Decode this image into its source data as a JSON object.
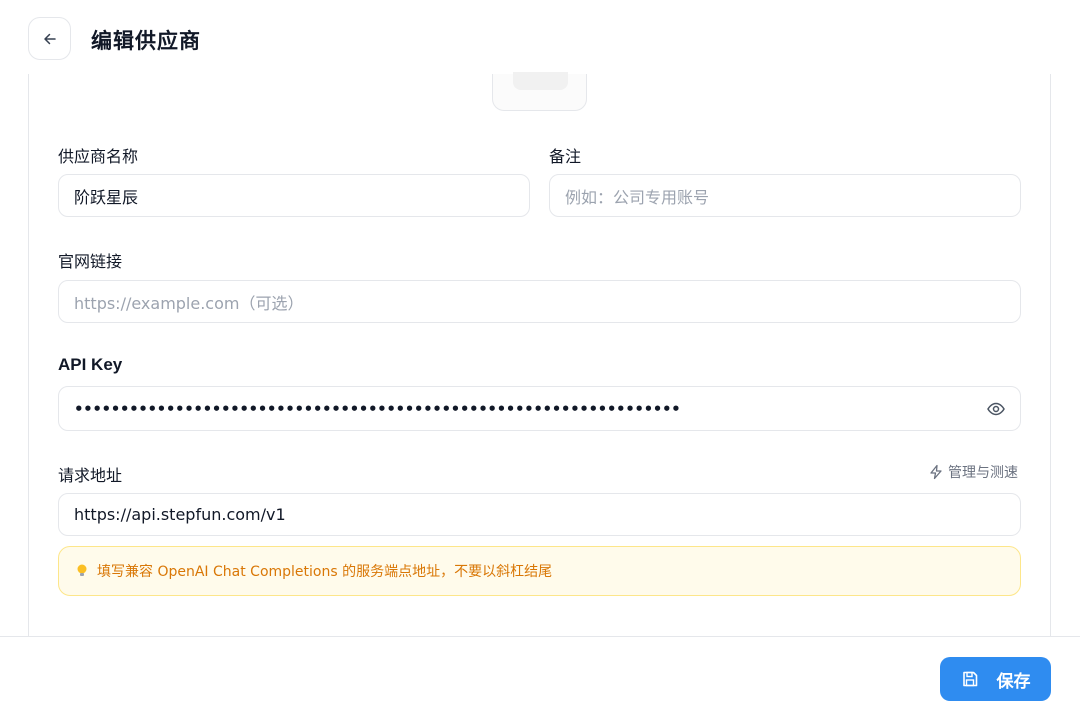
{
  "header": {
    "title": "编辑供应商",
    "back_icon": "arrow-left-icon"
  },
  "form": {
    "name": {
      "label": "供应商名称",
      "value": "阶跃星辰"
    },
    "note": {
      "label": "备注",
      "placeholder": "例如：公司专用账号"
    },
    "website": {
      "label": "官网链接",
      "placeholder": "https://example.com（可选）"
    },
    "api_key": {
      "label": "API Key",
      "value": "••••••••••••••••••••••••••••••••••••••••••••••••••••••••••••••••••",
      "toggle_icon": "eye-icon"
    },
    "endpoint": {
      "label": "请求地址",
      "manage_label": "管理与测速",
      "manage_icon": "lightning-icon",
      "value": "https://api.stepfun.com/v1",
      "tip_icon": "lightbulb-icon",
      "tip": "填写兼容 OpenAI Chat Completions 的服务端点地址，不要以斜杠结尾"
    }
  },
  "footer": {
    "save_label": "保存",
    "save_icon": "save-icon"
  },
  "colors": {
    "accent": "#2f8cf0",
    "tip_text": "#d97706",
    "tip_bg": "#fffbeb"
  }
}
